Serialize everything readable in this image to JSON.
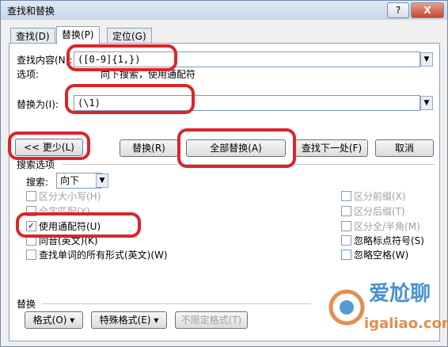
{
  "window": {
    "title": "查找和替换",
    "help_label": "?",
    "close_label": "X"
  },
  "tabs": [
    {
      "label": "查找(D)"
    },
    {
      "label": "替换(P)"
    },
    {
      "label": "定位(G)"
    }
  ],
  "find": {
    "label": "查找内容(N):",
    "value": "([0-9]{1,})",
    "options_label": "选项:",
    "options_value": "向下搜索，使用通配符"
  },
  "replace": {
    "label": "替换为(I):",
    "value": "(\\1)"
  },
  "buttons": {
    "less": "<< 更少(L)",
    "replace": "替换(R)",
    "replace_all": "全部替换(A)",
    "find_next": "查找下一处(F)",
    "cancel": "取消"
  },
  "search_options": {
    "heading": "搜索选项",
    "search_label": "搜索:",
    "search_value": "向下",
    "left": [
      {
        "label": "区分大小写(H)",
        "checked": false,
        "enabled": false
      },
      {
        "label": "全字匹配(Y)",
        "checked": false,
        "enabled": false
      },
      {
        "label": "使用通配符(U)",
        "checked": true,
        "enabled": true
      },
      {
        "label": "同音(英文)(K)",
        "checked": false,
        "enabled": true
      },
      {
        "label": "查找单词的所有形式(英文)(W)",
        "checked": false,
        "enabled": true
      }
    ],
    "right": [
      {
        "label": "区分前缀(X)",
        "checked": false,
        "enabled": false
      },
      {
        "label": "区分后缀(T)",
        "checked": false,
        "enabled": false
      },
      {
        "label": "区分全/半角(M)",
        "checked": false,
        "enabled": false
      },
      {
        "label": "忽略标点符号(S)",
        "checked": false,
        "enabled": true
      },
      {
        "label": "忽略空格(W)",
        "checked": false,
        "enabled": true
      }
    ]
  },
  "replace_section": {
    "heading": "替换",
    "format": "格式(O) ▾",
    "special": "特殊格式(E) ▾",
    "no_format": "不限定格式(T)"
  },
  "watermark": {
    "brand": "爱尬聊",
    "url": "igaliao.com"
  },
  "colors": {
    "highlight_ring": "#d9262b"
  }
}
